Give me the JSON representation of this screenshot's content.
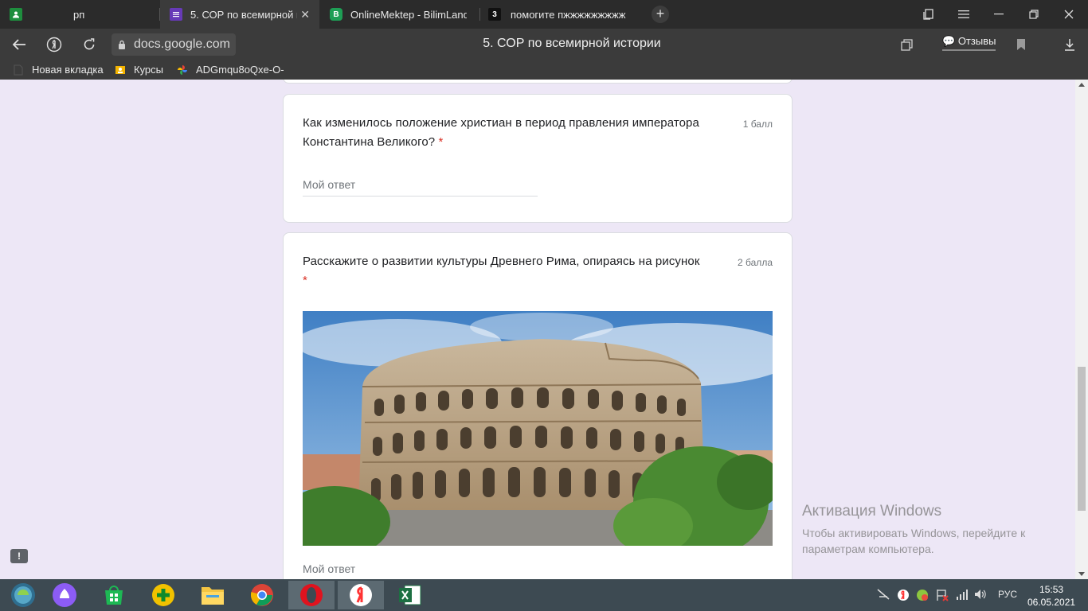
{
  "browser": {
    "tabs": [
      {
        "title": "рп",
        "favicon": "green-contact-icon"
      },
      {
        "title": "5. СОР по всемирной и",
        "favicon": "google-forms-icon"
      },
      {
        "title": "OnlineMektep - BilimLand",
        "favicon": "bilimland-icon"
      },
      {
        "title": "помогите пжжжжжжжжж",
        "favicon": "znanija-icon"
      }
    ],
    "address": "docs.google.com",
    "page_title": "5. СОР по всемирной истории",
    "feedback_label": "Отзывы",
    "bookmarks": [
      {
        "label": "Новая вкладка"
      },
      {
        "label": "Курсы"
      },
      {
        "label": "ADGmqu8oQxe-O-"
      }
    ]
  },
  "form": {
    "questions": [
      {
        "text": "Как изменилось положение христиан в период правления императора Константина Великого?",
        "required_mark": "*",
        "points": "1 балл",
        "answer_placeholder": "Мой ответ"
      },
      {
        "text": "Расскажите о развитии культуры Древнего Рима, опираясь на рисунок",
        "required_mark": "*",
        "points": "2 балла",
        "image": "colosseum-photo",
        "answer_placeholder": "Мой ответ"
      }
    ]
  },
  "watermark": {
    "title": "Активация Windows",
    "subtitle": "Чтобы активировать Windows, перейдите к параметрам компьютера."
  },
  "taskbar": {
    "language": "РУС",
    "time": "15:53",
    "date": "06.05.2021"
  }
}
